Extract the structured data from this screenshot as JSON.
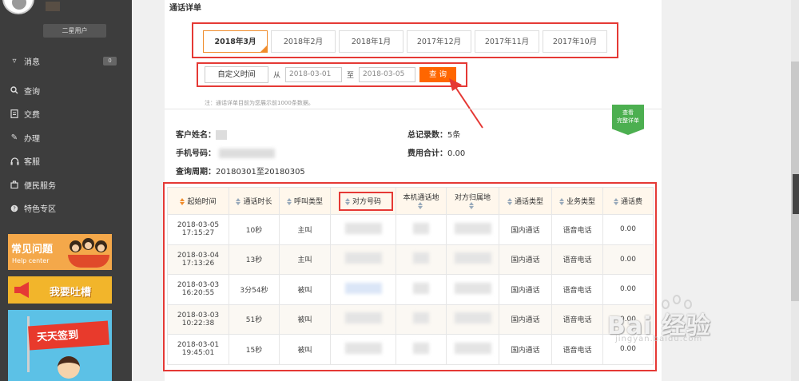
{
  "sidebar": {
    "user_level": "二星用户",
    "items": [
      {
        "label": "消息",
        "icon": "message-icon",
        "badge": "0"
      },
      {
        "label": "查询",
        "icon": "search-icon"
      },
      {
        "label": "交费",
        "icon": "bill-icon"
      },
      {
        "label": "办理",
        "icon": "pen-icon"
      },
      {
        "label": "客服",
        "icon": "headset-icon"
      },
      {
        "label": "便民服务",
        "icon": "service-icon"
      },
      {
        "label": "特色专区",
        "icon": "help-icon"
      }
    ],
    "promo_faq": {
      "title": "常见问题",
      "subtitle": "Help center"
    },
    "promo_complain": {
      "title": "我要吐槽"
    },
    "promo_sign": {
      "title": "天天签到"
    }
  },
  "content": {
    "section_title": "通话详单",
    "months": [
      "2018年3月",
      "2018年2月",
      "2018年1月",
      "2017年12月",
      "2017年11月",
      "2017年10月"
    ],
    "active_month": "2018年3月",
    "custom_time_label": "自定义时间",
    "from_label": "从",
    "from_date": "2018-03-01",
    "to_label": "至",
    "to_date": "2018-03-05",
    "query_button": "查 询",
    "note": "注：通话详单目前为您展示前1000条数据。",
    "view_all_badge": "查看\n完整详单",
    "customer_name_label": "客户姓名：",
    "phone_label": "手机号码：",
    "period_label": "查询周期：",
    "period_value": "20180301至20180305",
    "total_records_label": "总记录数：",
    "total_records_value": "5条",
    "total_fee_label": "费用合计：",
    "total_fee_value": "0.00"
  },
  "table": {
    "headers": [
      "起始时间",
      "通话时长",
      "呼叫类型",
      "对方号码",
      "本机通话地",
      "对方归属地",
      "通话类型",
      "业务类型",
      "通话费"
    ],
    "rows": [
      {
        "date": "2018-03-05",
        "time": "17:15:27",
        "duration": "10秒",
        "call_type": "主叫",
        "comm_type": "国内通话",
        "biz_type": "语音电话",
        "fee": "0.00"
      },
      {
        "date": "2018-03-04",
        "time": "17:13:26",
        "duration": "13秒",
        "call_type": "主叫",
        "comm_type": "国内通话",
        "biz_type": "语音电话",
        "fee": "0.00"
      },
      {
        "date": "2018-03-03",
        "time": "16:20:55",
        "duration": "3分54秒",
        "call_type": "被叫",
        "comm_type": "国内通话",
        "biz_type": "语音电话",
        "fee": "0.00"
      },
      {
        "date": "2018-03-03",
        "time": "10:22:38",
        "duration": "51秒",
        "call_type": "被叫",
        "comm_type": "国内通话",
        "biz_type": "语音电话",
        "fee": "0.00"
      },
      {
        "date": "2018-03-01",
        "time": "19:45:01",
        "duration": "15秒",
        "call_type": "被叫",
        "comm_type": "国内通话",
        "biz_type": "语音电话",
        "fee": "0.00"
      }
    ]
  },
  "watermark": {
    "brand": "Bai 经验",
    "url": "jingyan.baidu.com"
  },
  "colors": {
    "accent": "#ff6600",
    "highlight": "#e53935",
    "sidebar": "#3d3d3d",
    "badge_green": "#4caf50"
  }
}
